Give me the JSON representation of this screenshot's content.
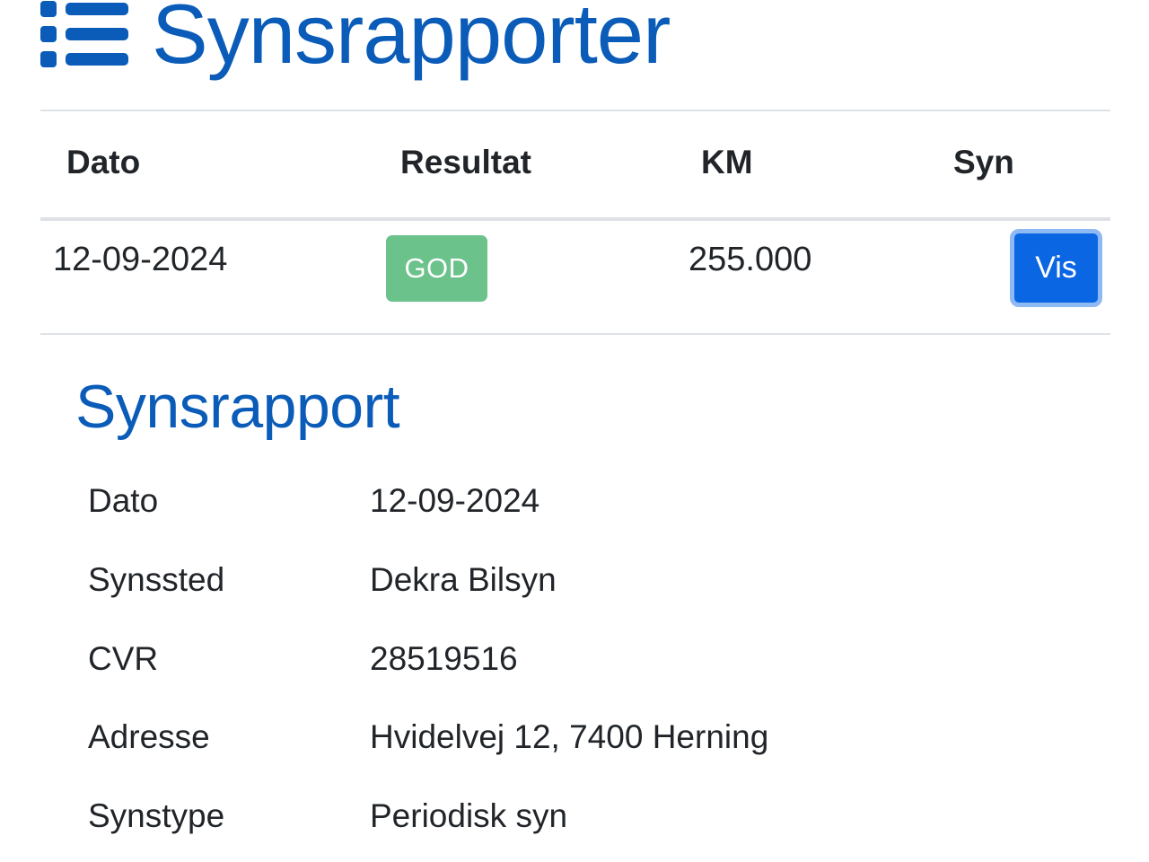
{
  "header": {
    "title": "Synsrapporter",
    "icon": "list-icon",
    "accent_color": "#0a5cb8"
  },
  "table": {
    "columns": [
      "Dato",
      "Resultat",
      "KM",
      "Syn"
    ],
    "rows": [
      {
        "date": "12-09-2024",
        "result": "GOD",
        "result_color": "#6cc28b",
        "km": "255.000",
        "action_label": "Vis",
        "action_color": "#0b66e4"
      }
    ]
  },
  "report": {
    "title": "Synsrapport",
    "fields": [
      {
        "label": "Dato",
        "value": "12-09-2024"
      },
      {
        "label": "Synssted",
        "value": "Dekra Bilsyn"
      },
      {
        "label": "CVR",
        "value": "28519516"
      },
      {
        "label": "Adresse",
        "value": "Hvidelvej 12, 7400 Herning"
      },
      {
        "label": "Synstype",
        "value": "Periodisk syn"
      }
    ]
  }
}
